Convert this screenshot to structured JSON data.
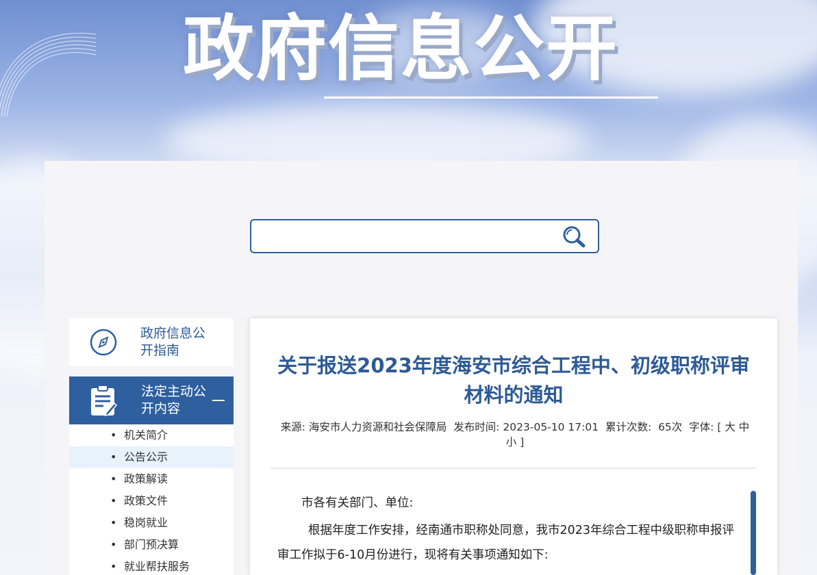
{
  "banner": {
    "title": "政府信息公开"
  },
  "search": {
    "placeholder": ""
  },
  "sidebar": {
    "guide_label": "政府信息公开指南",
    "section_label": "法定主动公开内容",
    "items": [
      {
        "label": "机关简介"
      },
      {
        "label": "公告公示"
      },
      {
        "label": "政策解读"
      },
      {
        "label": "政策文件"
      },
      {
        "label": "稳岗就业"
      },
      {
        "label": "部门预决算"
      },
      {
        "label": "就业帮扶服务"
      }
    ],
    "active_index": 1
  },
  "article": {
    "title": "关于报送2023年度海安市综合工程中、初级职称评审材料的通知",
    "meta": {
      "source_label": "来源:",
      "source": "海安市人力资源和社会保障局",
      "time_label": "发布时间:",
      "time": "2023-05-10 17:01",
      "views_label": "累计次数:",
      "views": "65次",
      "font_label": "字体:",
      "bracket_open": "[",
      "font_large": "大",
      "font_medium": "中",
      "font_small": "小",
      "bracket_close": "]"
    },
    "salutation": "市各有关部门、单位:",
    "paragraph": "根据年度工作安排，经南通市职称处同意，我市2023年综合工程中级职称申报评审工作拟于6-10月份进行，现将有关事项通知如下:"
  },
  "colors": {
    "brand_blue": "#2e5f9e",
    "title_blue": "#2d5a96",
    "active_item_bg": "#e8f2fb"
  }
}
